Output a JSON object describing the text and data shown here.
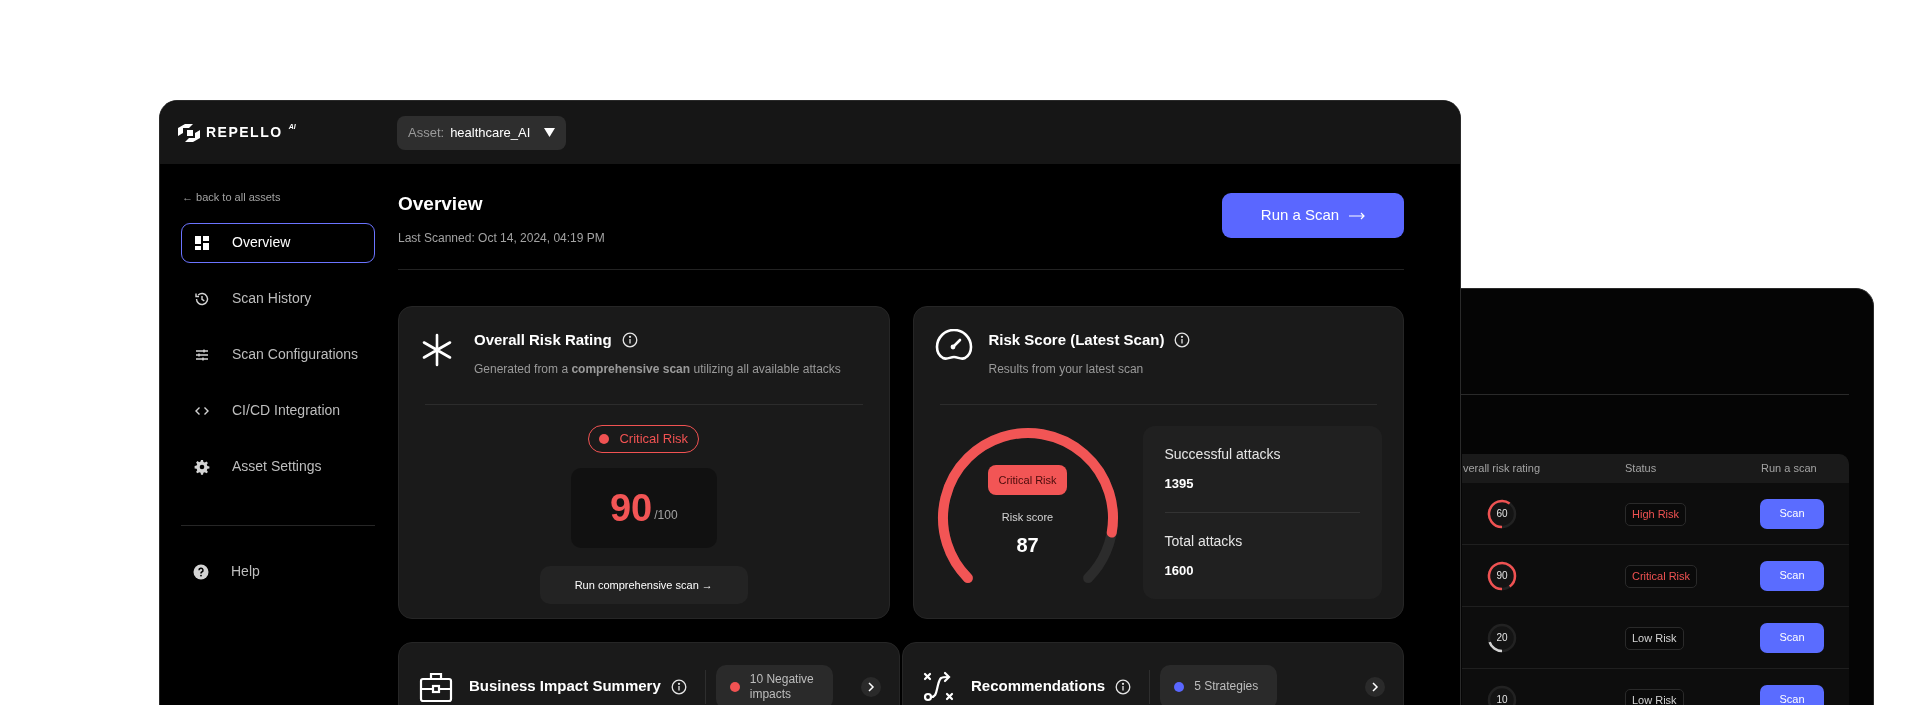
{
  "logo": {
    "name": "REPELLO",
    "tag": "AI"
  },
  "asset_selector": {
    "label": "Asset:",
    "value": "healthcare_AI"
  },
  "sidebar": {
    "back_link": "← back to all assets",
    "items": [
      {
        "label": "Overview",
        "kind": "grid",
        "selected": true
      },
      {
        "label": "Scan History",
        "kind": "history",
        "selected": false
      },
      {
        "label": "Scan Configurations",
        "kind": "sliders",
        "selected": false
      },
      {
        "label": "CI/CD Integration",
        "kind": "code",
        "selected": false
      },
      {
        "label": "Asset Settings",
        "kind": "gear",
        "selected": false
      }
    ],
    "help": {
      "label": "Help"
    }
  },
  "header": {
    "title": "Overview",
    "subtitle": "Last Scanned: Oct 14, 2024, 04:19 PM",
    "button": "Run a Scan"
  },
  "overall_risk": {
    "title": "Overall Risk Rating",
    "description": "Generated from a **comprehensive scan** utilizing all available attacks",
    "badge": "Critical Risk",
    "score": "90",
    "max": "/100",
    "button": "Run comprehensive scan →"
  },
  "risk_score": {
    "title": "Risk Score (Latest Scan)",
    "description": "Results from your latest scan",
    "badge": "Critical Risk",
    "score_label": "Risk score",
    "score": "87",
    "stats": [
      {
        "label": "Successful attacks",
        "value": "1395"
      },
      {
        "label": "Total attacks",
        "value": "1600"
      }
    ]
  },
  "summary_cards": [
    {
      "kind": "briefcase",
      "title": "Business Impact Summery",
      "pill": "10 Negative impacts",
      "color": "#f05252"
    },
    {
      "kind": "route",
      "title": "Recommendations",
      "pill": "5 Strategies",
      "color": "#5a67ff"
    }
  ],
  "back_table": {
    "columns": [
      "verall risk rating",
      "Status",
      "Run a scan"
    ],
    "rows": [
      {
        "rating": "60",
        "status": "High Risk",
        "color": "#f05252",
        "button": "Scan"
      },
      {
        "rating": "90",
        "status": "Critical Risk",
        "color": "#f05252",
        "button": "Scan"
      },
      {
        "rating": "20",
        "status": "Low Risk",
        "color": "#d4d4d4",
        "button": "Scan"
      },
      {
        "rating": "10",
        "status": "Low Risk",
        "color": "#d4d4d4",
        "button": "Scan"
      }
    ]
  }
}
